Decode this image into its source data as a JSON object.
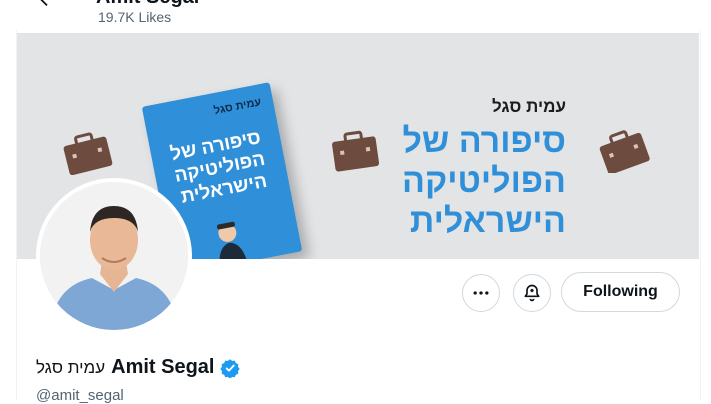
{
  "header": {
    "back_icon": "arrow-left-icon",
    "title": "Amit Segal",
    "likes": "19.7K Likes"
  },
  "banner": {
    "book_author": "עמית סגל",
    "book_title_line1": "סיפורה של",
    "book_title_line2": "הפוליטיקה",
    "book_title_line3": "הישראלית",
    "headline_author": "עמית סגל",
    "headline_line1": "סיפורה של",
    "headline_line2": "הפוליטיקה",
    "headline_line3": "הישראלית",
    "accent_color": "#2f8fd8",
    "icons": [
      "briefcase-icon",
      "briefcase-icon",
      "briefcase-icon"
    ]
  },
  "profile": {
    "avatar_icon": "avatar",
    "more_icon": "more-horizontal-icon",
    "notify_icon": "bell-notify-icon",
    "following_label": "Following",
    "name_hebrew": "עמית סגל",
    "name_english": "Amit Segal",
    "verified_icon": "verified-badge-icon",
    "verified_color": "#1d9bf0",
    "handle": "@amit_segal"
  }
}
